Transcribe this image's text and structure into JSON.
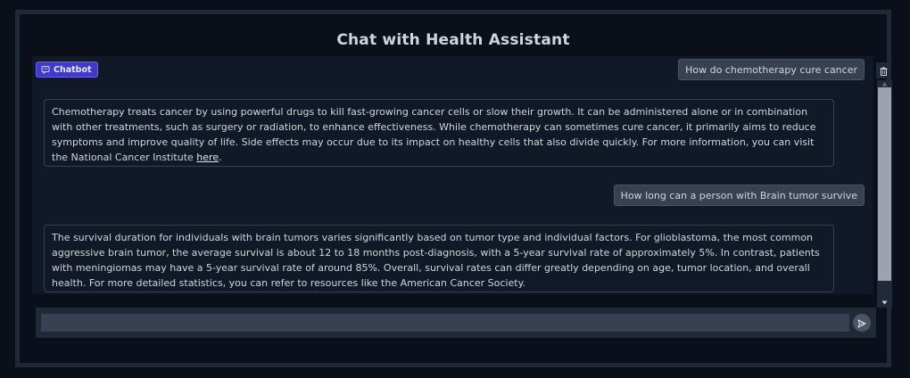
{
  "app": {
    "title": "Chat with Health Assistant"
  },
  "chatbot": {
    "label": "Chatbot"
  },
  "messages": [
    {
      "role": "user",
      "text": "How do chemotherapy cure cancer"
    },
    {
      "role": "assistant",
      "text": "Chemotherapy treats cancer by using powerful drugs to kill fast-growing cancer cells or slow their growth. It can be administered alone or in combination with other treatments, such as surgery or radiation, to enhance effectiveness. While chemotherapy can sometimes cure cancer, it primarily aims to reduce symptoms and improve quality of life. Side effects may occur due to its impact on healthy cells that also divide quickly. For more information, you can visit the National Cancer Institute ",
      "link_text": "here",
      "trailing": "."
    },
    {
      "role": "user",
      "text": "How long can a person with Brain tumor survive"
    },
    {
      "role": "assistant",
      "text": "The survival duration for individuals with brain tumors varies significantly based on tumor type and individual factors. For glioblastoma, the most common aggressive brain tumor, the average survival is about 12 to 18 months post-diagnosis, with a 5-year survival rate of approximately 5%. In contrast, patients with meningiomas may have a 5-year survival rate of around 85%. Overall, survival rates can differ greatly depending on age, tumor location, and overall health. For more detailed statistics, you can refer to resources like the American Cancer Society."
    }
  ],
  "input": {
    "value": "",
    "placeholder": ""
  },
  "icons": {
    "label": "chat-icon",
    "clear": "trash-icon",
    "send": "send-icon"
  },
  "colors": {
    "accent": "#4338ca",
    "background": "#0b0f19",
    "panel": "#111827"
  }
}
